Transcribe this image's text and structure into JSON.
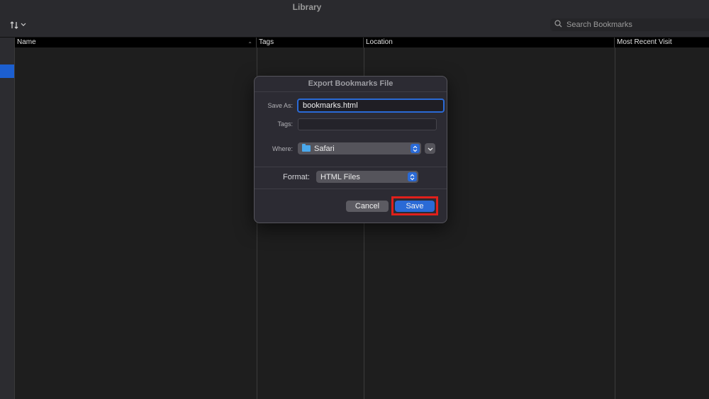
{
  "window": {
    "title": "Library"
  },
  "toolbar": {
    "search_placeholder": "Search Bookmarks"
  },
  "table": {
    "columns": [
      "Name",
      "Tags",
      "Location",
      "Most Recent Visit"
    ]
  },
  "dialog": {
    "title": "Export Bookmarks File",
    "save_as_label": "Save As:",
    "save_as_value": "bookmarks.html",
    "tags_label": "Tags:",
    "tags_value": "",
    "where_label": "Where:",
    "where_value": "Safari",
    "format_label": "Format:",
    "format_value": "HTML Files",
    "cancel_label": "Cancel",
    "save_label": "Save"
  },
  "colors": {
    "accent": "#2a6ad6",
    "highlight": "#e0201b",
    "sidebar_selection": "#1c5fd0"
  },
  "icons": {
    "sort": "sort-arrows-icon",
    "search": "magnifier-icon",
    "folder": "folder-icon",
    "popup": "up-down-chevron-icon",
    "expand": "chevron-down-icon"
  }
}
